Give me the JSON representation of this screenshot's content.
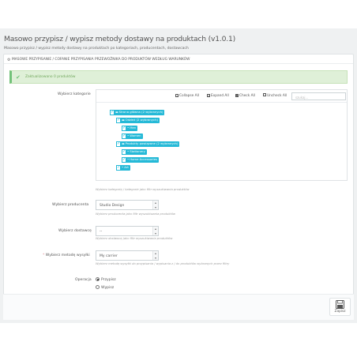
{
  "header": {
    "title": "Masowo przypisz / wypisz metody dostawy na produktach (v1.0.1)",
    "subtitle": "Masowo przypisz / wypisz metody dostawy na produktach po kategoriach, producentach, dostawcach"
  },
  "panel": {
    "heading_icon": "cog-icon",
    "heading": "Masowe przypisanie / Cofanie przypisania przewoźnika do produktów według warunków"
  },
  "alert": {
    "icon": "check-icon",
    "text": "Zaktualizowano 0 produktów",
    "color": "#72c279"
  },
  "category": {
    "label": "Wybierz kategorie",
    "toolbar": {
      "collapse_all": "Collapse All",
      "expand_all": "Expand All",
      "check_all": "Check All",
      "uncheck_all": "Uncheck All",
      "search_placeholder": "szukaj..."
    },
    "nodes": [
      {
        "label": "Strona główna (2 wybranych)",
        "checked": true
      },
      {
        "label": "Odzież (2 wybranych)",
        "checked": true
      },
      {
        "label": "Men",
        "checked": true
      },
      {
        "label": "Women",
        "checked": true
      },
      {
        "label": "Produkty powiązane (2 wybranych)",
        "checked": true
      },
      {
        "label": "Stationery",
        "checked": true
      },
      {
        "label": "Home Accessories",
        "checked": true
      },
      {
        "label": "Art",
        "checked": true
      }
    ],
    "help": "Wybierz kategorię / kategorie jako filtr wyszukiwania produktów",
    "accent": "#25b9d7"
  },
  "manufacturer": {
    "label": "Wybierz producenta",
    "value": "Studio Design",
    "help": "Wybierz producenta jako filtr wyszukiwania produktów"
  },
  "supplier": {
    "label": "Wybierz dostawcę",
    "value": "--",
    "help": "Wybierz dostawcę jako filtr wyszukiwania produktów"
  },
  "carrier": {
    "required_mark": "*",
    "label": "Wybierz metodę wysyłki",
    "value": "My carrier",
    "help": "Wybierz metodę wysyłki do przypisania / wypisania z / do produktów wybranych przez filtry"
  },
  "operation": {
    "label": "Operacja",
    "options": [
      {
        "label": "Przypisz",
        "selected": true
      },
      {
        "label": "Wypisz",
        "selected": false
      }
    ]
  },
  "footer": {
    "save_label": "Zapisz",
    "save_icon": "floppy-disk-icon"
  }
}
